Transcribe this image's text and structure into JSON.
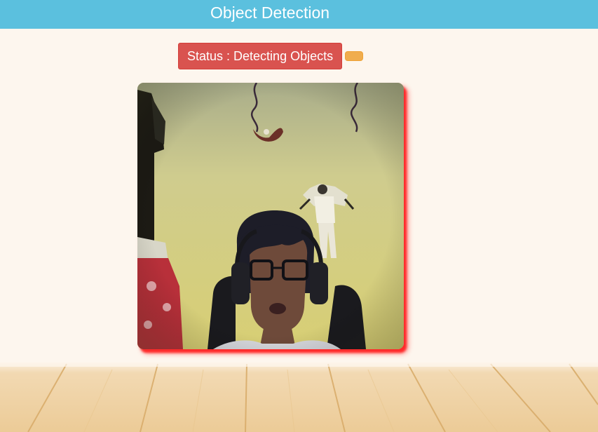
{
  "header": {
    "title": "Object Detection"
  },
  "status": {
    "label": "Status : Detecting Objects",
    "button_color": "#d9534f",
    "indicator_color": "#f0ad4e"
  },
  "video": {
    "border_glow_color": "#ff2a2a"
  },
  "theme": {
    "header_color": "#5bc0de",
    "background_color": "#fdf6ee"
  }
}
